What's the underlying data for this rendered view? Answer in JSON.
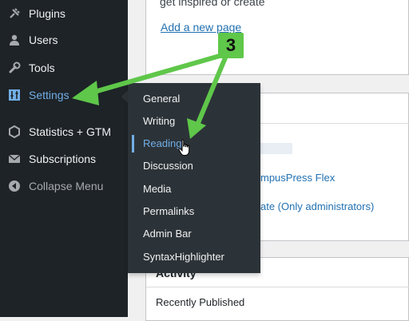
{
  "sidebar": {
    "items": [
      {
        "label": "Plugins",
        "icon": "plugin-icon",
        "glyph": "⚒"
      },
      {
        "label": "Users",
        "icon": "users-icon",
        "glyph": "●"
      },
      {
        "label": "Tools",
        "icon": "wrench-icon",
        "glyph": "⚒"
      },
      {
        "label": "Settings",
        "icon": "sliders-icon",
        "glyph": "☷"
      },
      {
        "label": "Statistics + GTM",
        "icon": "hexagon-icon",
        "glyph": "⬡"
      },
      {
        "label": "Subscriptions",
        "icon": "envelope-icon",
        "glyph": "✉"
      },
      {
        "label": "Collapse Menu",
        "icon": "collapse-icon",
        "glyph": "◀"
      }
    ]
  },
  "settings_submenu": {
    "items": [
      "General",
      "Writing",
      "Reading",
      "Discussion",
      "Media",
      "Permalinks",
      "Admin Bar",
      "SyntaxHighlighter"
    ]
  },
  "content": {
    "top_text": "get inspired or create",
    "add_page_link": "Add a new page",
    "mid_link_1": "mpusPress Flex",
    "mid_link_2": "ate (Only administrators)",
    "activity_title": "Activity",
    "recently_published": "Recently Published"
  },
  "annotation": {
    "step_number": "3",
    "color": "#5fc74a"
  },
  "colors": {
    "sidebar_bg": "#1d2327",
    "flyout_bg": "#2c3338",
    "accent": "#72aee6",
    "link": "#2271b1"
  }
}
